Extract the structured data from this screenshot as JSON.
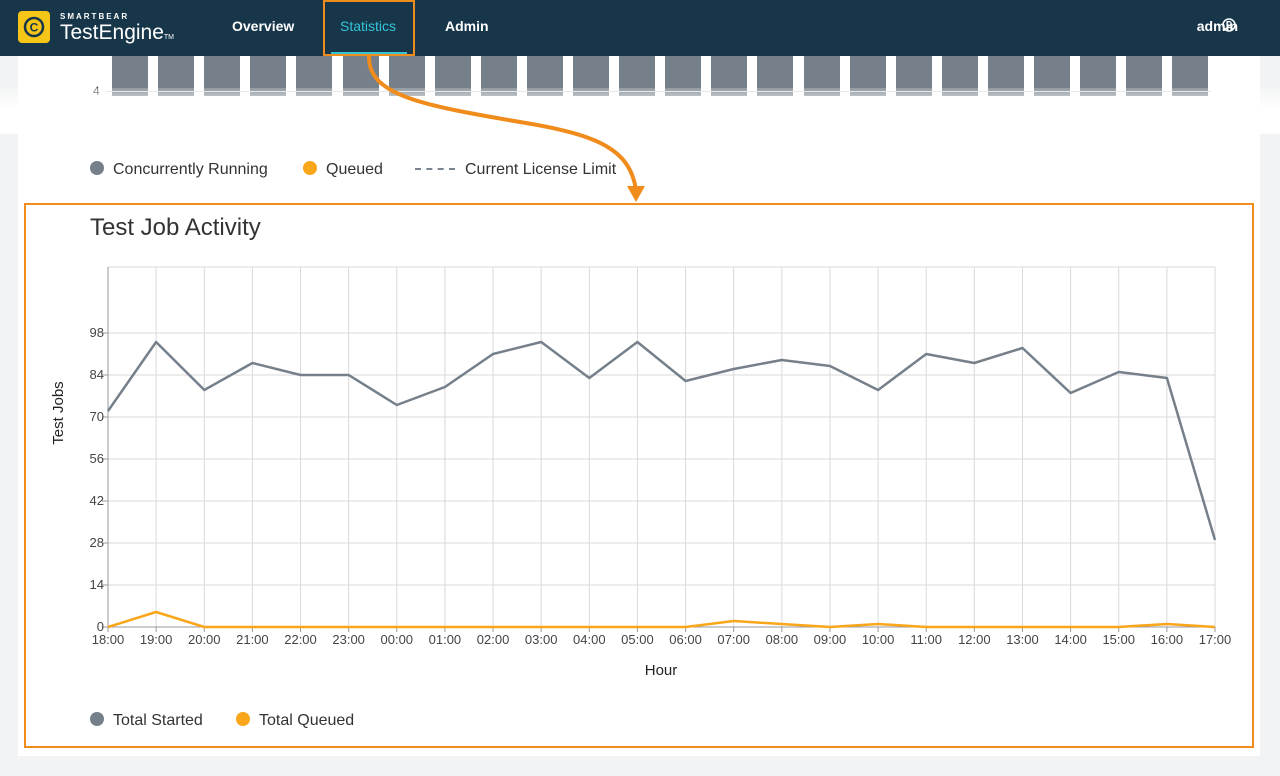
{
  "app": {
    "brand_small": "SMARTBEAR",
    "brand_name": "TestEngine",
    "brand_tm": "TM"
  },
  "nav": {
    "items": [
      {
        "label": "Overview"
      },
      {
        "label": "Statistics"
      },
      {
        "label": "Admin"
      }
    ],
    "active": "Statistics",
    "user": "admin"
  },
  "top_chart": {
    "partial_tick": "4",
    "legend": [
      {
        "label": "Concurrently Running",
        "color": "#76808a",
        "marker": "dot"
      },
      {
        "label": "Queued",
        "color": "#f9a61a",
        "marker": "dot"
      },
      {
        "label": "Current License Limit",
        "color": "#7a8590",
        "marker": "dash"
      }
    ]
  },
  "chart_data": {
    "type": "line",
    "title": "Test Job Activity",
    "xlabel": "Hour",
    "ylabel": "Test Jobs",
    "categories": [
      "18:00",
      "19:00",
      "20:00",
      "21:00",
      "22:00",
      "23:00",
      "00:00",
      "01:00",
      "02:00",
      "03:00",
      "04:00",
      "05:00",
      "06:00",
      "07:00",
      "08:00",
      "09:00",
      "10:00",
      "11:00",
      "12:00",
      "13:00",
      "14:00",
      "15:00",
      "16:00",
      "17:00"
    ],
    "yticks": [
      0,
      14,
      28,
      42,
      56,
      70,
      84,
      98
    ],
    "ylim": [
      0,
      120
    ],
    "grid": true,
    "legend_position": "bottom-left",
    "series": [
      {
        "name": "Total Started",
        "color": "#76808a",
        "values": [
          72,
          95,
          79,
          88,
          84,
          84,
          74,
          80,
          91,
          95,
          83,
          95,
          82,
          86,
          89,
          87,
          79,
          91,
          88,
          93,
          78,
          85,
          83,
          29
        ]
      },
      {
        "name": "Total Queued",
        "color": "#f9a61a",
        "values": [
          0,
          5,
          0,
          0,
          0,
          0,
          0,
          0,
          0,
          0,
          0,
          0,
          0,
          2,
          1,
          0,
          1,
          0,
          0,
          0,
          0,
          0,
          1,
          0
        ]
      }
    ]
  }
}
